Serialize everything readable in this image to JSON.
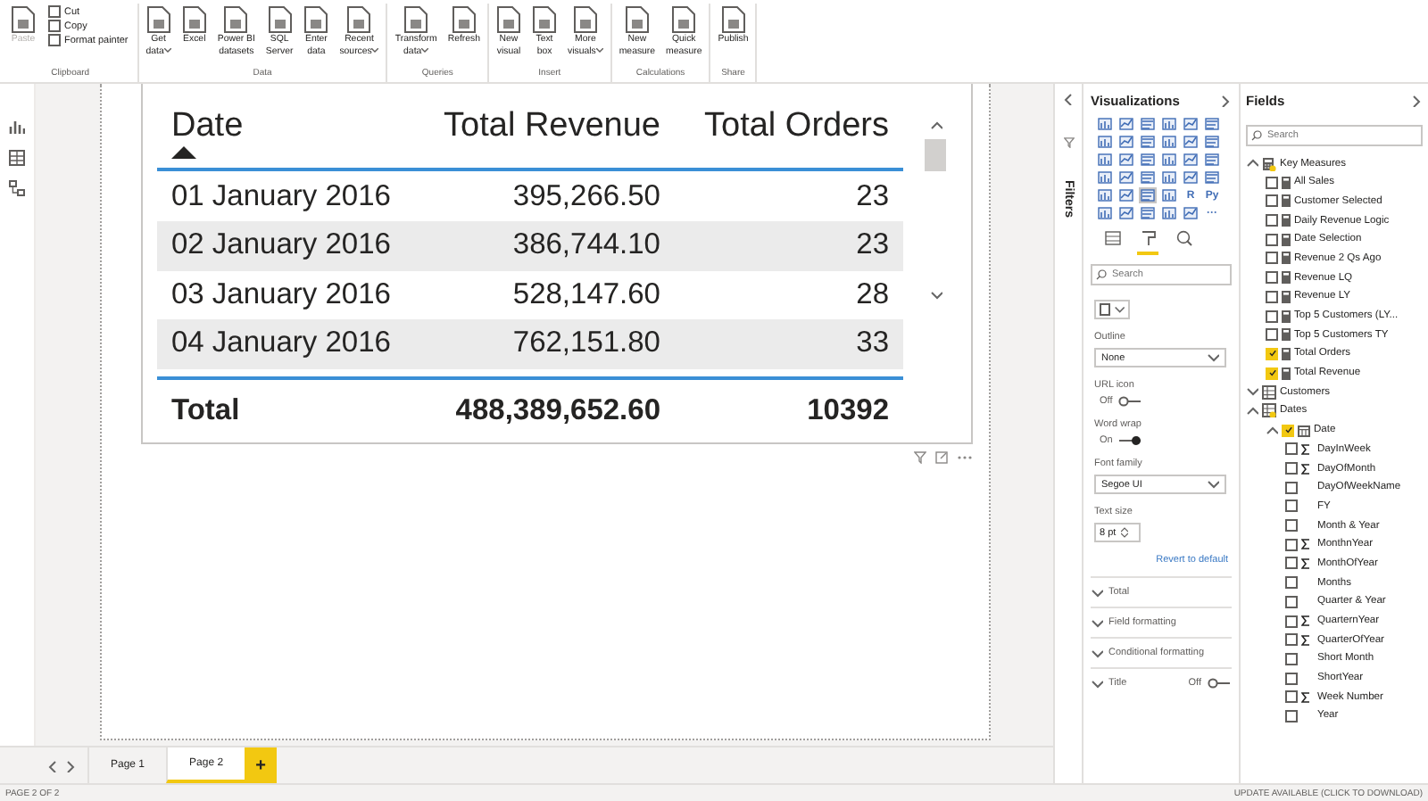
{
  "ribbon": {
    "groups": [
      {
        "label": "Clipboard",
        "buttons": [
          {
            "kind": "large",
            "lines": [
              "Paste"
            ],
            "disabled": true,
            "dropdown": false
          },
          {
            "kind": "small",
            "lines": [
              "Cut"
            ],
            "disabled": false,
            "dropdown": false
          },
          {
            "kind": "small",
            "lines": [
              "Copy"
            ],
            "disabled": false,
            "dropdown": false
          },
          {
            "kind": "small",
            "lines": [
              "Format painter"
            ],
            "disabled": false,
            "dropdown": false
          }
        ]
      },
      {
        "label": "Data",
        "buttons": [
          {
            "kind": "large",
            "lines": [
              "Get",
              "data"
            ],
            "disabled": false,
            "dropdown": true
          },
          {
            "kind": "large",
            "lines": [
              "Excel"
            ],
            "disabled": false,
            "dropdown": false
          },
          {
            "kind": "large",
            "lines": [
              "Power BI",
              "datasets"
            ],
            "disabled": false,
            "dropdown": false
          },
          {
            "kind": "large",
            "lines": [
              "SQL",
              "Server"
            ],
            "disabled": false,
            "dropdown": false
          },
          {
            "kind": "large",
            "lines": [
              "Enter",
              "data"
            ],
            "disabled": false,
            "dropdown": false
          },
          {
            "kind": "large",
            "lines": [
              "Recent",
              "sources"
            ],
            "disabled": false,
            "dropdown": true
          }
        ]
      },
      {
        "label": "Queries",
        "buttons": [
          {
            "kind": "large",
            "lines": [
              "Transform",
              "data"
            ],
            "disabled": false,
            "dropdown": true
          },
          {
            "kind": "large",
            "lines": [
              "Refresh"
            ],
            "disabled": false,
            "dropdown": false
          }
        ]
      },
      {
        "label": "Insert",
        "buttons": [
          {
            "kind": "large",
            "lines": [
              "New",
              "visual"
            ],
            "disabled": false,
            "dropdown": false
          },
          {
            "kind": "large",
            "lines": [
              "Text",
              "box"
            ],
            "disabled": false,
            "dropdown": false
          },
          {
            "kind": "large",
            "lines": [
              "More",
              "visuals"
            ],
            "disabled": false,
            "dropdown": true
          }
        ]
      },
      {
        "label": "Calculations",
        "buttons": [
          {
            "kind": "large",
            "lines": [
              "New",
              "measure"
            ],
            "disabled": false,
            "dropdown": false
          },
          {
            "kind": "large",
            "lines": [
              "Quick",
              "measure"
            ],
            "disabled": false,
            "dropdown": false
          }
        ]
      },
      {
        "label": "Share",
        "buttons": [
          {
            "kind": "large",
            "lines": [
              "Publish"
            ],
            "disabled": false,
            "dropdown": false
          }
        ]
      }
    ]
  },
  "table_visual": {
    "columns": [
      {
        "label": "Date",
        "sorted": true
      },
      {
        "label": "Total Revenue",
        "sorted": false
      },
      {
        "label": "Total Orders",
        "sorted": false
      }
    ],
    "rows": [
      [
        "01 January 2016",
        "395,266.50",
        "23"
      ],
      [
        "02 January 2016",
        "386,744.10",
        "23"
      ],
      [
        "03 January 2016",
        "528,147.60",
        "28"
      ],
      [
        "04 January 2016",
        "762,151.80",
        "33"
      ]
    ],
    "total": [
      "Total",
      "488,389,652.60",
      "10392"
    ]
  },
  "filters_pane": {
    "title": "Filters"
  },
  "visualizations": {
    "title": "Visualizations",
    "types": [
      {
        "selected": false
      },
      {
        "selected": false
      },
      {
        "selected": false
      },
      {
        "selected": false
      },
      {
        "selected": false
      },
      {
        "selected": false
      },
      {
        "selected": false
      },
      {
        "selected": false
      },
      {
        "selected": false
      },
      {
        "selected": false
      },
      {
        "selected": false
      },
      {
        "selected": false
      },
      {
        "selected": false
      },
      {
        "selected": false
      },
      {
        "selected": false
      },
      {
        "selected": false
      },
      {
        "selected": false
      },
      {
        "selected": false
      },
      {
        "selected": false
      },
      {
        "selected": false
      },
      {
        "selected": false
      },
      {
        "selected": false
      },
      {
        "selected": false
      },
      {
        "selected": false
      },
      {
        "selected": false
      },
      {
        "selected": false
      },
      {
        "selected": true
      },
      {
        "selected": false
      },
      {
        "selected": false,
        "label": "R"
      },
      {
        "selected": false,
        "label": "Py"
      },
      {
        "selected": false
      },
      {
        "selected": false
      },
      {
        "selected": false
      },
      {
        "selected": false
      },
      {
        "selected": false
      },
      {
        "selected": false,
        "label": "···"
      }
    ],
    "tabs": [
      {
        "selected": false
      },
      {
        "selected": true
      },
      {
        "selected": false
      }
    ],
    "search": {
      "placeholder": "Search"
    },
    "settings": [
      {
        "kind": "swatch"
      },
      {
        "kind": "dropdown",
        "label": "Outline",
        "value": "None"
      },
      {
        "kind": "toggle",
        "label": "URL icon",
        "text": "Off",
        "on": false
      },
      {
        "kind": "toggle",
        "label": "Word wrap",
        "text": "On",
        "on": true
      },
      {
        "kind": "dropdown",
        "label": "Font family",
        "value": "Segoe UI"
      },
      {
        "kind": "spinner",
        "label": "Text size",
        "value": "8",
        "unit": "pt"
      },
      {
        "kind": "link",
        "label": "Revert to default"
      },
      {
        "kind": "section",
        "label": "Total"
      },
      {
        "kind": "section",
        "label": "Field formatting"
      },
      {
        "kind": "section",
        "label": "Conditional formatting"
      },
      {
        "kind": "section",
        "label": "Title",
        "toggle": {
          "text": "Off",
          "on": false
        }
      }
    ]
  },
  "fields": {
    "title": "Fields",
    "search": {
      "placeholder": "Search"
    },
    "tree": [
      {
        "label": "Key Measures",
        "kind": "measure_table",
        "expanded": true,
        "has_selection": true,
        "children": [
          {
            "label": "All Sales",
            "kind": "measure",
            "checked": false
          },
          {
            "label": "Customer Selected",
            "kind": "measure",
            "checked": false
          },
          {
            "label": "Daily Revenue Logic",
            "kind": "measure",
            "checked": false
          },
          {
            "label": "Date Selection",
            "kind": "measure",
            "checked": false
          },
          {
            "label": "Revenue 2 Qs Ago",
            "kind": "measure",
            "checked": false
          },
          {
            "label": "Revenue LQ",
            "kind": "measure",
            "checked": false
          },
          {
            "label": "Revenue LY",
            "kind": "measure",
            "checked": false
          },
          {
            "label": "Top 5 Customers (LY...",
            "kind": "measure",
            "checked": false
          },
          {
            "label": "Top 5 Customers TY",
            "kind": "measure",
            "checked": false
          },
          {
            "label": "Total Orders",
            "kind": "measure",
            "checked": true
          },
          {
            "label": "Total Revenue",
            "kind": "measure",
            "checked": true
          }
        ]
      },
      {
        "label": "Customers",
        "kind": "table",
        "expanded": false,
        "has_selection": false
      },
      {
        "label": "Dates",
        "kind": "table",
        "expanded": true,
        "has_selection": true,
        "children": [
          {
            "label": "Date",
            "kind": "hierarchy",
            "checked": true,
            "expanded": true,
            "children": [
              {
                "label": "DayInWeek",
                "kind": "column",
                "aggregate": true,
                "checked": false
              },
              {
                "label": "DayOfMonth",
                "kind": "column",
                "aggregate": true,
                "checked": false
              },
              {
                "label": "DayOfWeekName",
                "kind": "column",
                "aggregate": false,
                "checked": false
              },
              {
                "label": "FY",
                "kind": "column",
                "aggregate": false,
                "checked": false
              },
              {
                "label": "Month & Year",
                "kind": "column",
                "aggregate": false,
                "checked": false
              },
              {
                "label": "MonthnYear",
                "kind": "column",
                "aggregate": true,
                "checked": false
              },
              {
                "label": "MonthOfYear",
                "kind": "column",
                "aggregate": true,
                "checked": false
              },
              {
                "label": "Months",
                "kind": "column",
                "aggregate": false,
                "checked": false
              },
              {
                "label": "Quarter & Year",
                "kind": "column",
                "aggregate": false,
                "checked": false
              },
              {
                "label": "QuarternYear",
                "kind": "column",
                "aggregate": true,
                "checked": false
              },
              {
                "label": "QuarterOfYear",
                "kind": "column",
                "aggregate": true,
                "checked": false
              },
              {
                "label": "Short Month",
                "kind": "column",
                "aggregate": false,
                "checked": false
              },
              {
                "label": "ShortYear",
                "kind": "column",
                "aggregate": false,
                "checked": false
              },
              {
                "label": "Week Number",
                "kind": "column",
                "aggregate": true,
                "checked": false
              },
              {
                "label": "Year",
                "kind": "column",
                "aggregate": false,
                "checked": false
              }
            ]
          }
        ]
      }
    ]
  },
  "page_tabs": [
    {
      "label": "Page 1",
      "selected": false
    },
    {
      "label": "Page 2",
      "selected": true
    }
  ],
  "add_page": {
    "label": "+"
  },
  "status_bar": {
    "left": "PAGE 2 OF 2",
    "right": "UPDATE AVAILABLE (CLICK TO DOWNLOAD)"
  }
}
